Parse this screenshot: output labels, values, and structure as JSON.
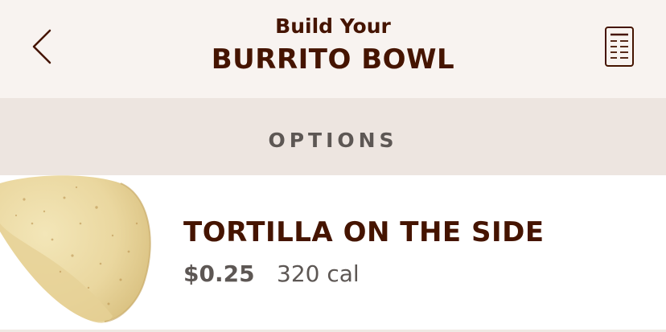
{
  "header": {
    "title_small": "Build Your",
    "title_big": "BURRITO BOWL",
    "back_icon": "chevron-left-icon",
    "menu_icon": "menu-document-icon"
  },
  "section": {
    "label": "OPTIONS"
  },
  "option": {
    "name": "TORTILLA ON THE SIDE",
    "price": "$0.25",
    "calories": "320 cal",
    "image": "tortilla-image"
  },
  "colors": {
    "brand_brown": "#451400",
    "header_bg": "#f8f3f0",
    "section_bg": "#ede5e0",
    "muted_text": "#5d5754"
  }
}
